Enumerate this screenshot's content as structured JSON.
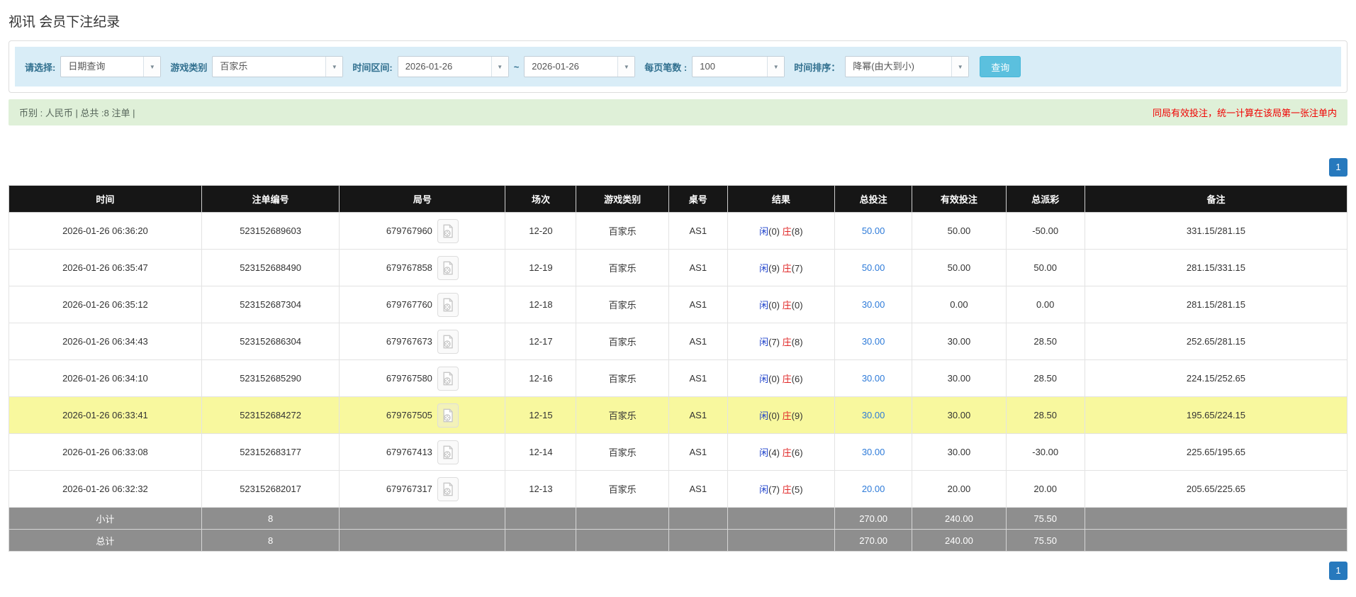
{
  "page_title": "视讯 会员下注纪录",
  "filter_bar": {
    "query_type": {
      "label": "请选择:",
      "value": "日期查询"
    },
    "game_category": {
      "label": "游戏类别",
      "value": "百家乐"
    },
    "time_range": {
      "label": "时间区间:",
      "from": "2026-01-26",
      "separator": "~",
      "to": "2026-01-26"
    },
    "page_size": {
      "label": "每页笔数 :",
      "value": "100"
    },
    "time_sort": {
      "label": "时间排序：",
      "value": "降幂(由大到小)"
    },
    "search_button": "查询"
  },
  "summary_bar": {
    "left_text": "币别 : 人民币 | 总共 :8 注单 |",
    "right_text": "同局有效投注，统一计算在该局第一张注单内"
  },
  "pagination": {
    "page": "1"
  },
  "table": {
    "columns": [
      "时间",
      "注单编号",
      "局号",
      "场次",
      "游戏类别",
      "桌号",
      "结果",
      "总投注",
      "有效投注",
      "总派彩",
      "备注"
    ],
    "rows": [
      {
        "time": "2026-01-26 06:36:20",
        "bet_no": "523152689603",
        "round_no": "679767960",
        "session": "12-20",
        "game": "百家乐",
        "table_no": "AS1",
        "player_label": "闲",
        "player_score": "(0)",
        "banker_label": "庄",
        "banker_score": "(8)",
        "total_bet": "50.00",
        "valid_bet": "50.00",
        "payout": "-50.00",
        "remark": "331.15/281.15",
        "highlight": false
      },
      {
        "time": "2026-01-26 06:35:47",
        "bet_no": "523152688490",
        "round_no": "679767858",
        "session": "12-19",
        "game": "百家乐",
        "table_no": "AS1",
        "player_label": "闲",
        "player_score": "(9)",
        "banker_label": "庄",
        "banker_score": "(7)",
        "total_bet": "50.00",
        "valid_bet": "50.00",
        "payout": "50.00",
        "remark": "281.15/331.15",
        "highlight": false
      },
      {
        "time": "2026-01-26 06:35:12",
        "bet_no": "523152687304",
        "round_no": "679767760",
        "session": "12-18",
        "game": "百家乐",
        "table_no": "AS1",
        "player_label": "闲",
        "player_score": "(0)",
        "banker_label": "庄",
        "banker_score": "(0)",
        "total_bet": "30.00",
        "valid_bet": "0.00",
        "payout": "0.00",
        "remark": "281.15/281.15",
        "highlight": false
      },
      {
        "time": "2026-01-26 06:34:43",
        "bet_no": "523152686304",
        "round_no": "679767673",
        "session": "12-17",
        "game": "百家乐",
        "table_no": "AS1",
        "player_label": "闲",
        "player_score": "(7)",
        "banker_label": "庄",
        "banker_score": "(8)",
        "total_bet": "30.00",
        "valid_bet": "30.00",
        "payout": "28.50",
        "remark": "252.65/281.15",
        "highlight": false
      },
      {
        "time": "2026-01-26 06:34:10",
        "bet_no": "523152685290",
        "round_no": "679767580",
        "session": "12-16",
        "game": "百家乐",
        "table_no": "AS1",
        "player_label": "闲",
        "player_score": "(0)",
        "banker_label": "庄",
        "banker_score": "(6)",
        "total_bet": "30.00",
        "valid_bet": "30.00",
        "payout": "28.50",
        "remark": "224.15/252.65",
        "highlight": false
      },
      {
        "time": "2026-01-26 06:33:41",
        "bet_no": "523152684272",
        "round_no": "679767505",
        "session": "12-15",
        "game": "百家乐",
        "table_no": "AS1",
        "player_label": "闲",
        "player_score": "(0)",
        "banker_label": "庄",
        "banker_score": "(9)",
        "total_bet": "30.00",
        "valid_bet": "30.00",
        "payout": "28.50",
        "remark": "195.65/224.15",
        "highlight": true
      },
      {
        "time": "2026-01-26 06:33:08",
        "bet_no": "523152683177",
        "round_no": "679767413",
        "session": "12-14",
        "game": "百家乐",
        "table_no": "AS1",
        "player_label": "闲",
        "player_score": "(4)",
        "banker_label": "庄",
        "banker_score": "(6)",
        "total_bet": "30.00",
        "valid_bet": "30.00",
        "payout": "-30.00",
        "remark": "225.65/195.65",
        "highlight": false
      },
      {
        "time": "2026-01-26 06:32:32",
        "bet_no": "523152682017",
        "round_no": "679767317",
        "session": "12-13",
        "game": "百家乐",
        "table_no": "AS1",
        "player_label": "闲",
        "player_score": "(7)",
        "banker_label": "庄",
        "banker_score": "(5)",
        "total_bet": "20.00",
        "valid_bet": "20.00",
        "payout": "20.00",
        "remark": "205.65/225.65",
        "highlight": false
      }
    ],
    "footer": [
      {
        "label": "小计",
        "count": "8",
        "total_bet": "270.00",
        "valid_bet": "240.00",
        "payout": "75.50"
      },
      {
        "label": "总计",
        "count": "8",
        "total_bet": "270.00",
        "valid_bet": "240.00",
        "payout": "75.50"
      }
    ]
  },
  "colors": {
    "filter_bg": "#d9edf7",
    "filter_label": "#31708f",
    "summary_bg": "#dff0d8",
    "summary_note_red": "#f00000",
    "header_bg": "#161616",
    "highlight_row": "#f8f89e",
    "footer_bg": "#8e8e8e",
    "link_blue": "#2e7bd9",
    "player_blue": "#2144cc",
    "banker_red": "#e02626",
    "negative_red": "#e60000",
    "search_button_bg": "#5bc0de",
    "pagination_bg": "#2779bd"
  }
}
